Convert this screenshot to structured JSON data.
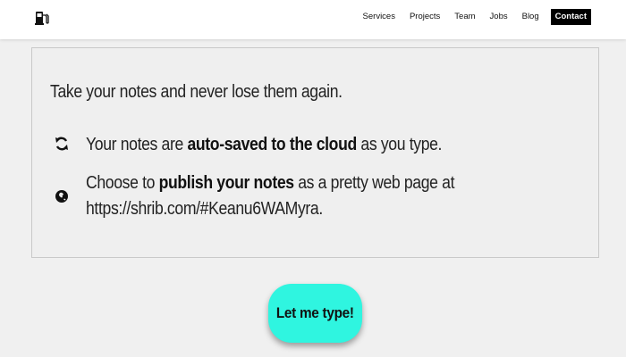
{
  "navbar": {
    "logo_icon": "fuel-pump-icon",
    "links": [
      "Services",
      "Projects",
      "Team",
      "Jobs",
      "Blog"
    ],
    "contact_label": "Contact"
  },
  "card": {
    "intro": "Take your notes and never lose them again.",
    "features": [
      {
        "icon": "sync-icon",
        "before": "Your notes are ",
        "bold": "auto-saved to the cloud",
        "after": " as you type."
      },
      {
        "icon": "globe-icon",
        "before": "Choose to ",
        "bold": "publish your notes",
        "after": " as a pretty web page at",
        "line2": "https://shrib.com/#Keanu6WAMyra."
      }
    ]
  },
  "cta": {
    "label": "Let me type!",
    "color": "#2ff5e0"
  }
}
